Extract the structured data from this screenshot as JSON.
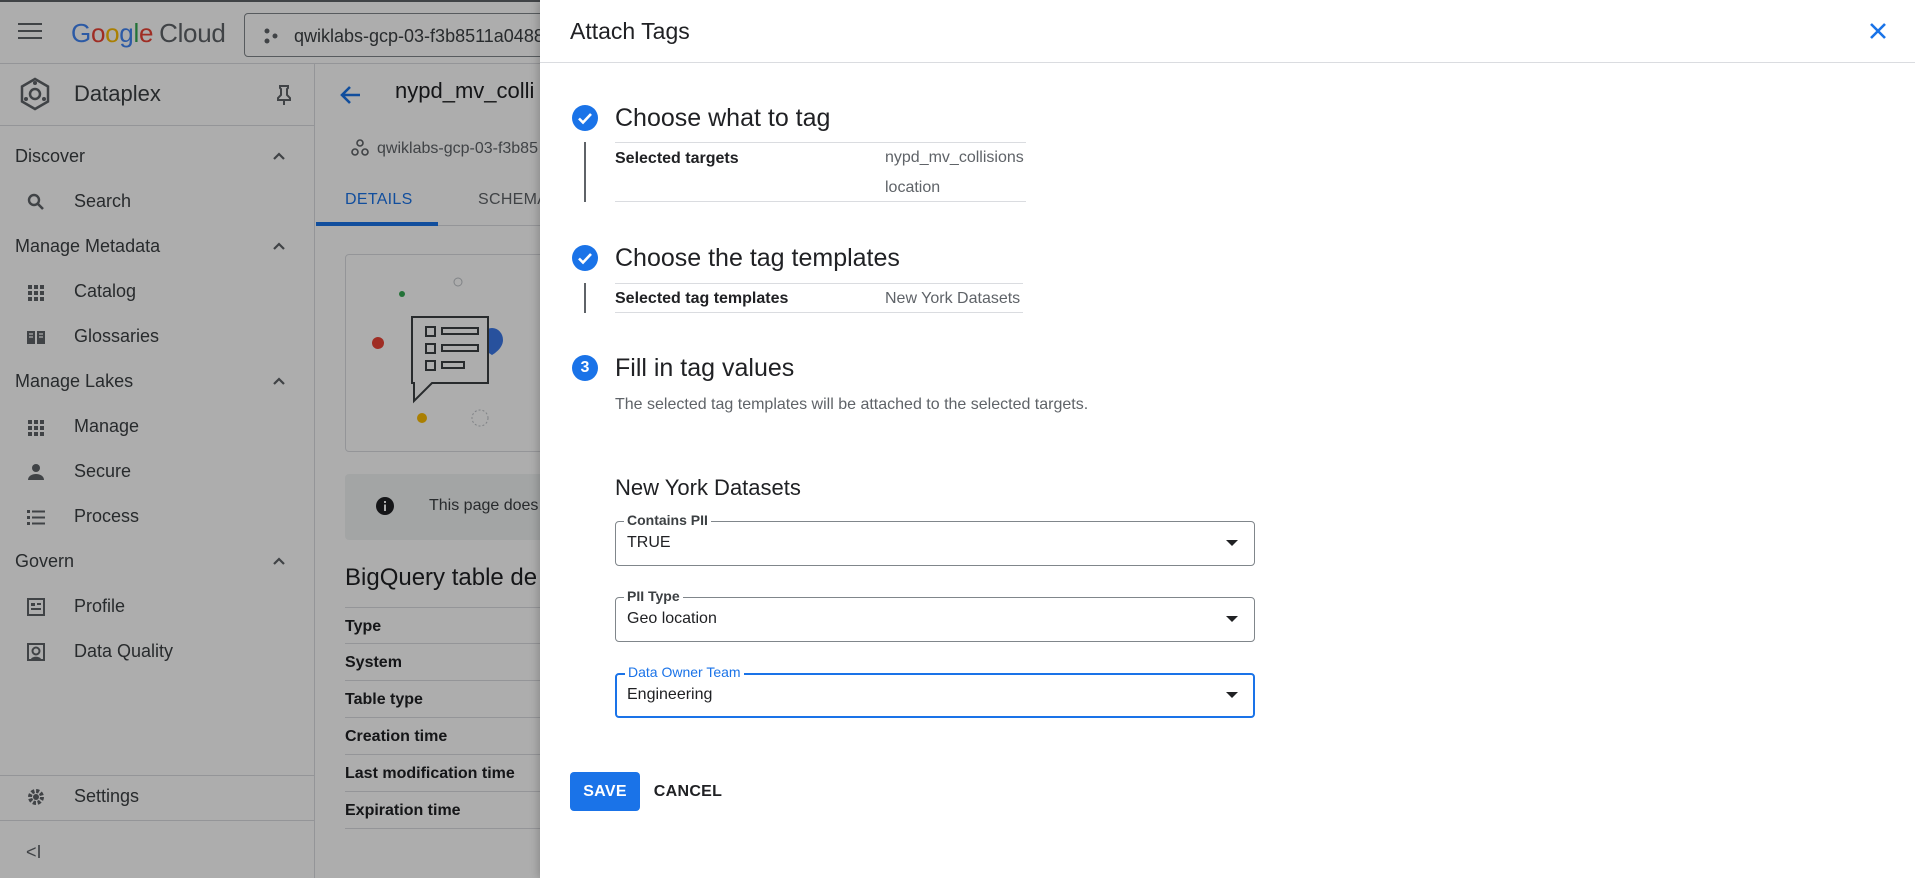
{
  "topbar": {
    "logo": {
      "letters": [
        "G",
        "o",
        "o",
        "g",
        "l",
        "e"
      ],
      "suffix": "Cloud"
    },
    "project": "qwiklabs-gcp-03-f3b8511a0488"
  },
  "sidebar": {
    "title": "Dataplex",
    "sections": [
      {
        "label": "Discover",
        "items": [
          {
            "label": "Search",
            "icon": "search-icon"
          }
        ]
      },
      {
        "label": "Manage Metadata",
        "items": [
          {
            "label": "Catalog",
            "icon": "grid-icon"
          },
          {
            "label": "Glossaries",
            "icon": "book-icon"
          }
        ]
      },
      {
        "label": "Manage Lakes",
        "items": [
          {
            "label": "Manage",
            "icon": "grid-icon"
          },
          {
            "label": "Secure",
            "icon": "person-icon"
          },
          {
            "label": "Process",
            "icon": "list-icon"
          }
        ]
      },
      {
        "label": "Govern",
        "items": [
          {
            "label": "Profile",
            "icon": "profile-icon"
          },
          {
            "label": "Data Quality",
            "icon": "data-quality-icon"
          }
        ]
      }
    ],
    "settings": "Settings",
    "collapse": "<I"
  },
  "main": {
    "title": "nypd_mv_colli",
    "breadcrumb": "qwiklabs-gcp-03-f3b85",
    "tabs": [
      "DETAILS",
      "SCHEMA"
    ],
    "info_banner": "This page does",
    "bq_title": "BigQuery table de",
    "bq_rows": [
      "Type",
      "System",
      "Table type",
      "Creation time",
      "Last modification time",
      "Expiration time"
    ]
  },
  "panel": {
    "title": "Attach Tags",
    "steps": [
      {
        "title": "Choose what to tag",
        "state": "complete"
      },
      {
        "title": "Choose the tag templates",
        "state": "complete"
      },
      {
        "number": "3",
        "title": "Fill in tag values",
        "state": "active"
      }
    ],
    "step1_summary": {
      "key": "Selected targets",
      "values": [
        "nypd_mv_collisions",
        "location"
      ]
    },
    "step2_summary": {
      "key": "Selected tag templates",
      "value": "New York Datasets"
    },
    "step3_description": "The selected tag templates will be attached to the selected targets.",
    "template_title": "New York Datasets",
    "fields": [
      {
        "label": "Contains PII",
        "value": "TRUE",
        "focused": false
      },
      {
        "label": "PII Type",
        "value": "Geo location",
        "focused": false
      },
      {
        "label": "Data Owner Team",
        "value": "Engineering",
        "focused": true
      }
    ],
    "save_label": "SAVE",
    "cancel_label": "CANCEL"
  },
  "colors": {
    "accent": "#1a73e8",
    "text": "#202124",
    "muted": "#5f6368",
    "border": "#dadce0"
  }
}
